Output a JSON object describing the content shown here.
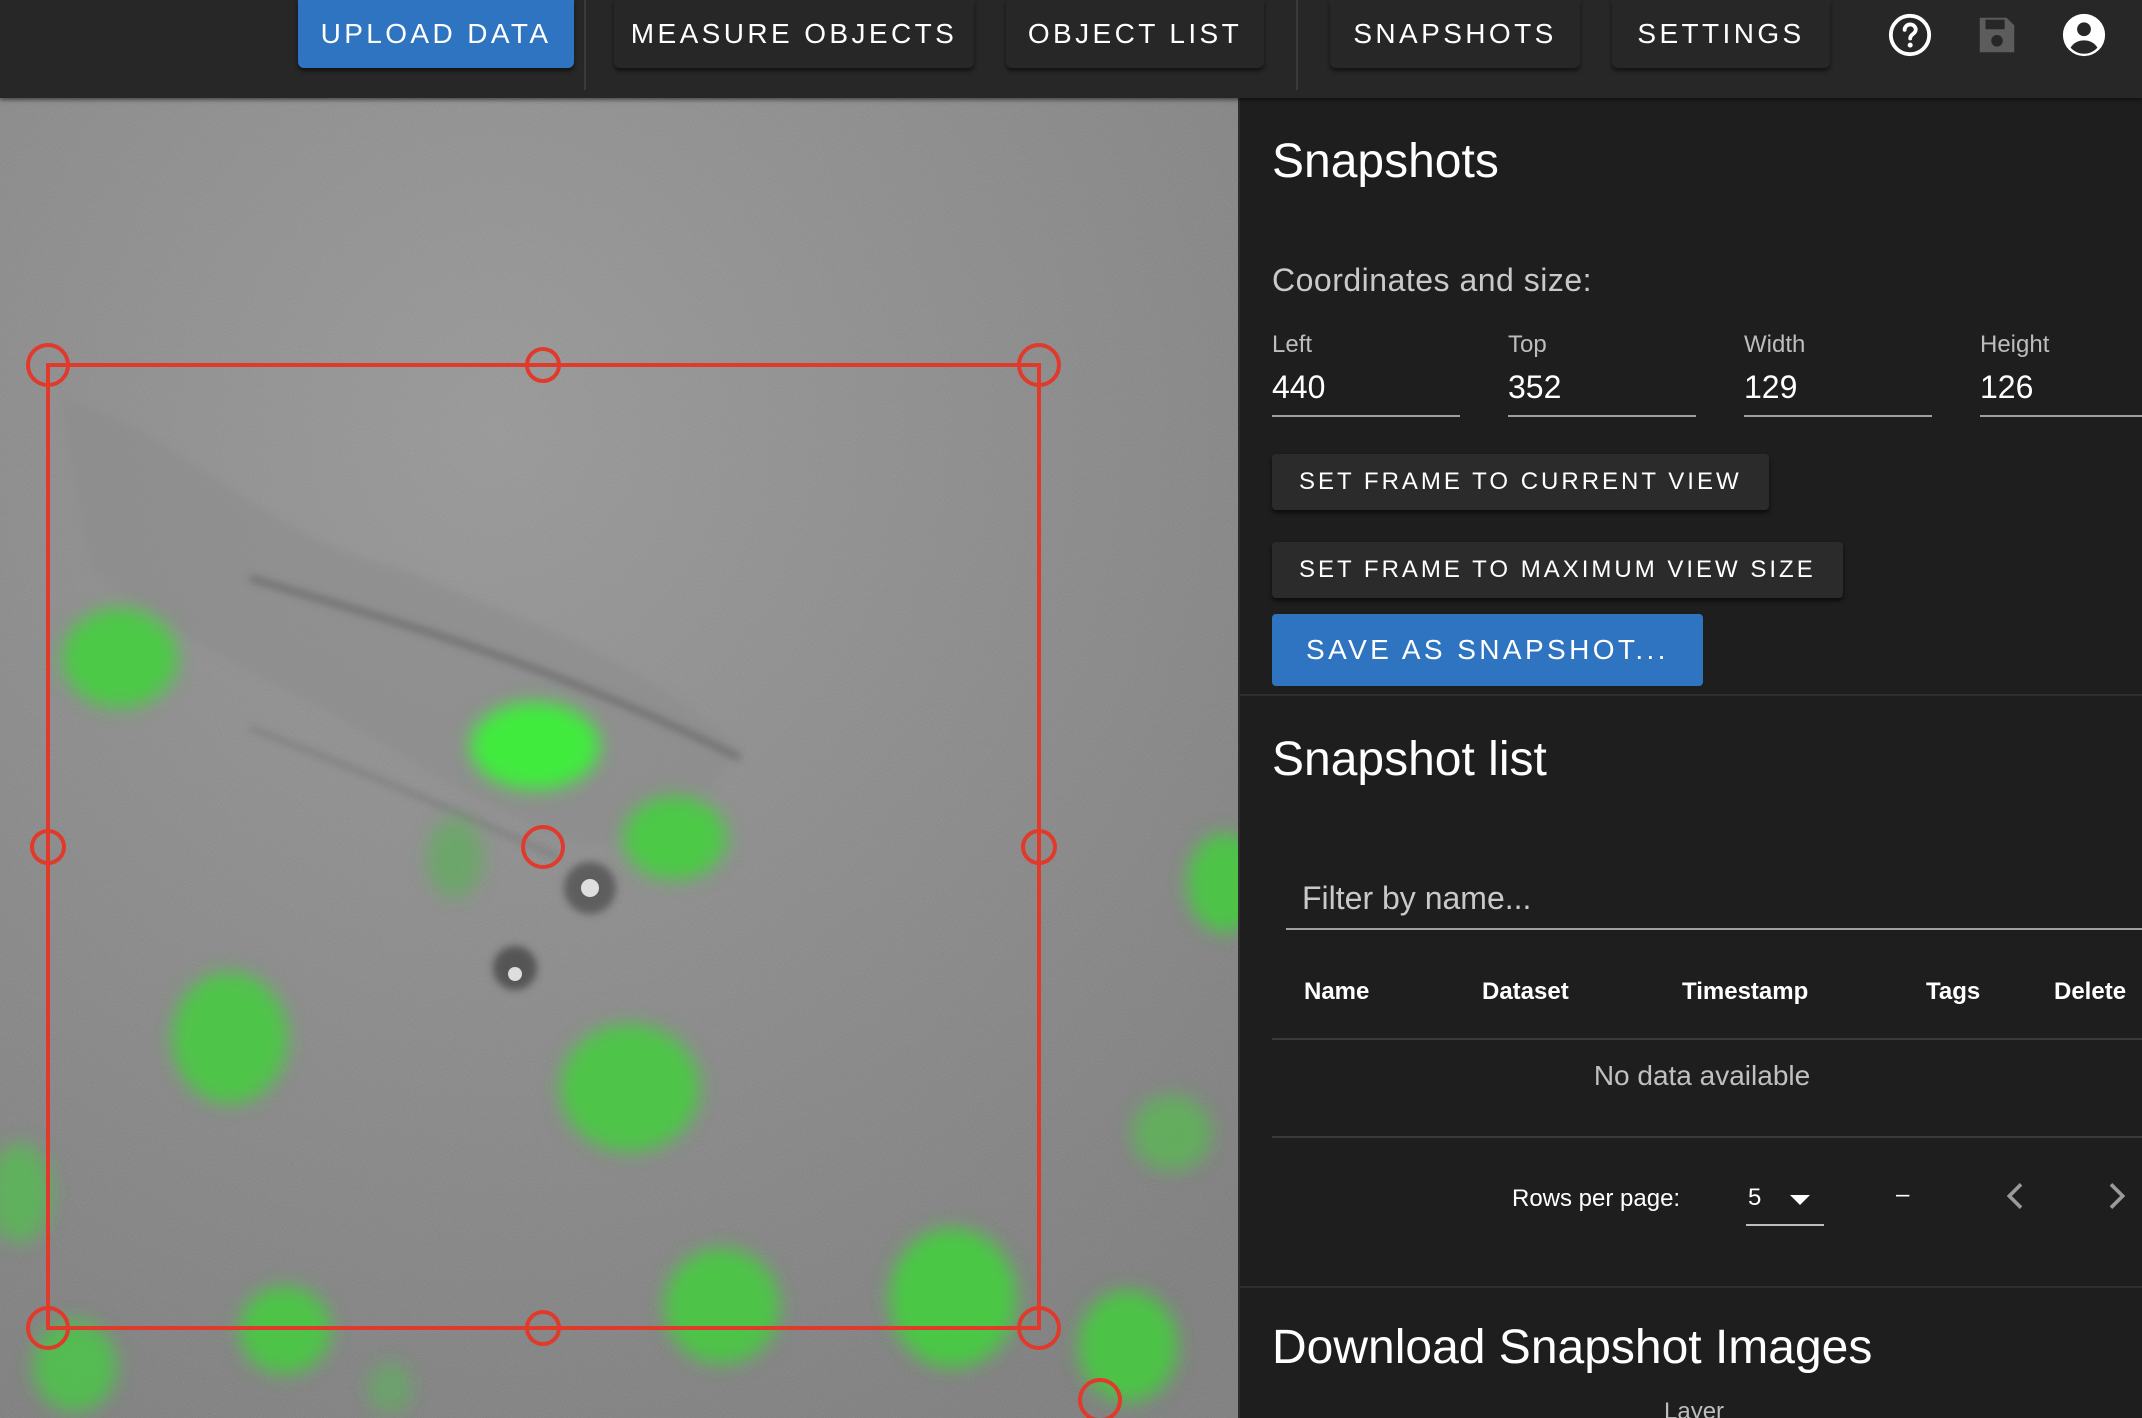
{
  "nav": {
    "upload_data": "UPLOAD DATA",
    "measure_objects": "MEASURE OBJECTS",
    "object_list": "OBJECT LIST",
    "snapshots": "SNAPSHOTS",
    "settings": "SETTINGS",
    "icons": [
      "help-circle-icon",
      "save-icon",
      "account-circle-icon"
    ]
  },
  "snapshots_panel": {
    "title": "Snapshots",
    "coords_heading": "Coordinates and size:",
    "fields": {
      "left": {
        "label": "Left",
        "value": "440"
      },
      "top": {
        "label": "Top",
        "value": "352"
      },
      "width": {
        "label": "Width",
        "value": "129"
      },
      "height": {
        "label": "Height",
        "value": "126"
      }
    },
    "set_frame_current": "SET FRAME TO CURRENT VIEW",
    "set_frame_max": "SET FRAME TO MAXIMUM VIEW SIZE",
    "save_snapshot": "SAVE AS SNAPSHOT..."
  },
  "snapshot_list": {
    "title": "Snapshot list",
    "filter_placeholder": "Filter by name...",
    "columns": [
      "Name",
      "Dataset",
      "Timestamp",
      "Tags",
      "Delete"
    ],
    "empty_text": "No data available",
    "rows_per_page_label": "Rows per page:",
    "rows_per_page_value": "5",
    "page_range": "–"
  },
  "download": {
    "title": "Download Snapshot Images",
    "layer_label": "Layer"
  },
  "colors": {
    "accent_blue": "#2f74c0",
    "selection_red": "#e03a2c",
    "cell_green": "#3ddc3a",
    "panel_bg": "#1e1e1e"
  }
}
